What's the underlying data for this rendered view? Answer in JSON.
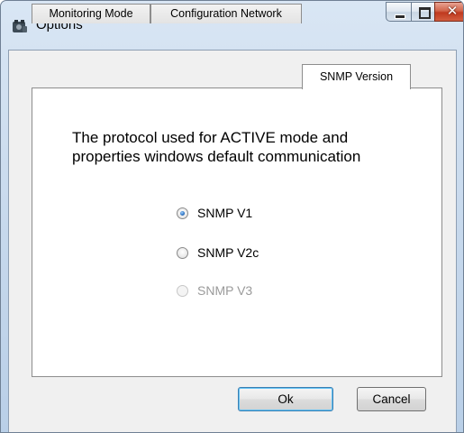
{
  "window": {
    "title": "Options"
  },
  "tabs": [
    {
      "label": "Monitoring Mode",
      "active": false
    },
    {
      "label": "Configuration Network",
      "active": false
    },
    {
      "label": "SNMP Version",
      "active": true
    }
  ],
  "panel": {
    "description_line1": "The protocol used for ACTIVE mode and",
    "description_line2": "properties windows default communication",
    "options": [
      {
        "label": "SNMP V1",
        "checked": true,
        "enabled": true
      },
      {
        "label": "SNMP V2c",
        "checked": false,
        "enabled": true
      },
      {
        "label": "SNMP V3",
        "checked": false,
        "enabled": false
      }
    ]
  },
  "buttons": {
    "ok_label": "Ok",
    "cancel_label": "Cancel"
  },
  "icons": {
    "app": "app-icon",
    "minimize": "minimize-icon",
    "maximize": "maximize-icon",
    "close": "close-icon"
  }
}
